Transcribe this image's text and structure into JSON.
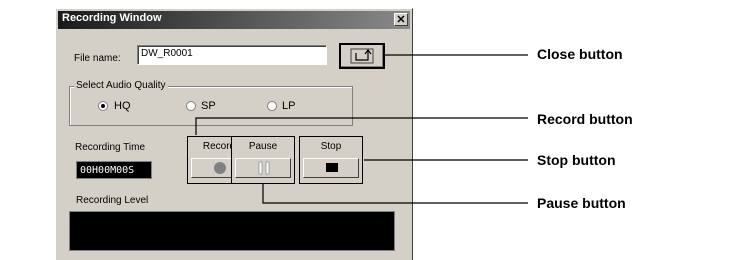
{
  "window": {
    "title": "Recording Window",
    "close_glyph": "✕"
  },
  "file": {
    "label": "File name:",
    "value": "DW_R0001",
    "close_icon": "close-arrow-icon"
  },
  "quality": {
    "group_label": "Select Audio Quality",
    "options": [
      {
        "label": "HQ",
        "checked": true
      },
      {
        "label": "SP",
        "checked": false
      },
      {
        "label": "LP",
        "checked": false
      }
    ]
  },
  "recording_time": {
    "label": "Recording Time",
    "value": "00H00M00S"
  },
  "controls": {
    "record_label": "Record",
    "pause_label": "Pause",
    "stop_label": "Stop"
  },
  "level": {
    "label": "Recording Level"
  },
  "callouts": {
    "close": "Close button",
    "record": "Record button",
    "stop": "Stop button",
    "pause": "Pause button"
  }
}
